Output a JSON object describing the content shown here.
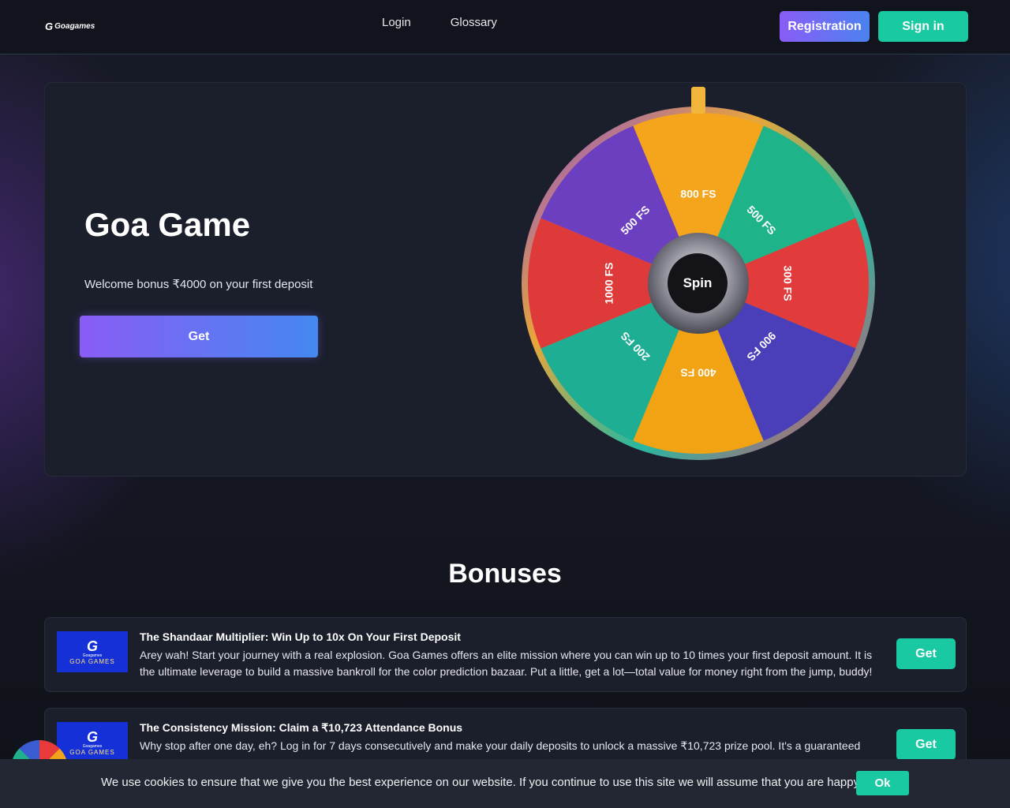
{
  "header": {
    "logo_text": "Goagames",
    "logo_mark": "G",
    "nav": [
      "Login",
      "Glossary"
    ],
    "registration_label": "Registration",
    "signin_label": "Sign in"
  },
  "hero": {
    "title": "Goa Game",
    "subtitle": "Welcome bonus ₹4000 on your first deposit",
    "get_label": "Get"
  },
  "wheel": {
    "spin_label": "Spin",
    "segments": [
      {
        "label": "800 FS",
        "color": "#f5a51c"
      },
      {
        "label": "500 FS",
        "color": "#1fb389"
      },
      {
        "label": "300 FS",
        "color": "#e13b3b"
      },
      {
        "label": "900 FS",
        "color": "#4a3fb8"
      },
      {
        "label": "400 FS",
        "color": "#f2a313"
      },
      {
        "label": "200 FS",
        "color": "#1eae93"
      },
      {
        "label": "1000 FS",
        "color": "#de3a3a"
      },
      {
        "label": "500 FS",
        "color": "#6b3fc0"
      }
    ]
  },
  "bonuses": {
    "title": "Bonuses",
    "thumb_brand_small": "Goagames",
    "thumb_brand_name": "GOA GAMES",
    "items": [
      {
        "title": "The Shandaar Multiplier: Win Up to 10x On Your First Deposit",
        "desc": "Arey wah! Start your journey with a real explosion. Goa Games offers an elite mission where you can win up to 10 times your first deposit amount. It is the ultimate leverage to build a massive bankroll for the color prediction bazaar. Put a little, get a lot—total value for money right from the jump, buddy!",
        "get_label": "Get"
      },
      {
        "title": "The Consistency Mission: Claim a ₹10,723 Attendance Bonus",
        "desc": "Why stop after one day, eh? Log in for 7 days consecutively and make your daily deposits to unlock a massive ₹10,723 prize pool. It's a guaranteed way",
        "get_label": "Get"
      }
    ]
  },
  "cookie": {
    "text": "We use cookies to ensure that we give you the best experience on our website. If you continue to use this site we will assume that you are happy with it.",
    "ok_label": "Ok"
  }
}
